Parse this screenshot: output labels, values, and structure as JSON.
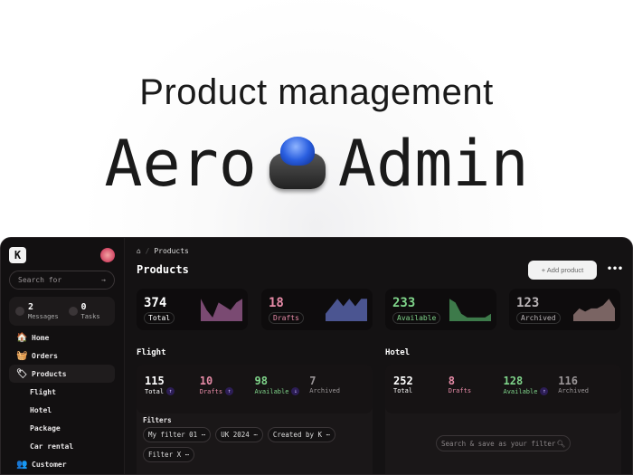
{
  "hero": {
    "subtitle": "Product management",
    "brand_left": "Aero",
    "brand_right": "Admin"
  },
  "sidebar": {
    "logo": "K",
    "search_placeholder": "Search for",
    "messages": {
      "count": "2",
      "label": "Messages"
    },
    "tasks": {
      "count": "0",
      "label": "Tasks"
    },
    "items": [
      {
        "label": "Home",
        "icon": "🏠"
      },
      {
        "label": "Orders",
        "icon": "🧺"
      },
      {
        "label": "Products",
        "icon": "🏷"
      },
      {
        "label": "Flight"
      },
      {
        "label": "Hotel"
      },
      {
        "label": "Package"
      },
      {
        "label": "Car rental"
      },
      {
        "label": "Customer",
        "icon": "👥"
      }
    ]
  },
  "header": {
    "breadcrumb": "Products",
    "title": "Products",
    "add_label": "+ Add product",
    "more": "•••"
  },
  "cards": [
    {
      "value": "374",
      "label": "Total",
      "color": "#ffffff",
      "fill": "#7a4a72",
      "spark": [
        6,
        3,
        1,
        5,
        4,
        3,
        5,
        6
      ]
    },
    {
      "value": "18",
      "label": "Drafts",
      "color": "#e58aa6",
      "fill": "#4b5591",
      "spark": [
        1,
        2,
        3,
        2,
        3,
        2,
        3,
        3
      ]
    },
    {
      "value": "233",
      "label": "Available",
      "color": "#7fd48a",
      "fill": "#3d7a4a",
      "spark": [
        6,
        5,
        2,
        1,
        1,
        1,
        1,
        2
      ]
    },
    {
      "value": "123",
      "label": "Archived",
      "color": "#b9b4b6",
      "fill": "#7a6463",
      "spark": [
        2,
        4,
        3,
        4,
        4,
        5,
        7,
        4
      ]
    }
  ],
  "flight": {
    "title": "Flight",
    "metrics": [
      {
        "value": "115",
        "label": "Total"
      },
      {
        "value": "10",
        "label": "Drafts"
      },
      {
        "value": "98",
        "label": "Available"
      },
      {
        "value": "7",
        "label": "Archived"
      }
    ],
    "filters_label": "Filters",
    "filters": [
      "My filter 01 ⋯",
      "UK 2024 ⋯",
      "Created by K ⋯",
      "Filter X ⋯"
    ]
  },
  "hotel": {
    "title": "Hotel",
    "metrics": [
      {
        "value": "252",
        "label": "Total"
      },
      {
        "value": "8",
        "label": "Drafts"
      },
      {
        "value": "128",
        "label": "Available"
      },
      {
        "value": "116",
        "label": "Archived"
      }
    ],
    "search_placeholder": "Search & save as your filter"
  }
}
